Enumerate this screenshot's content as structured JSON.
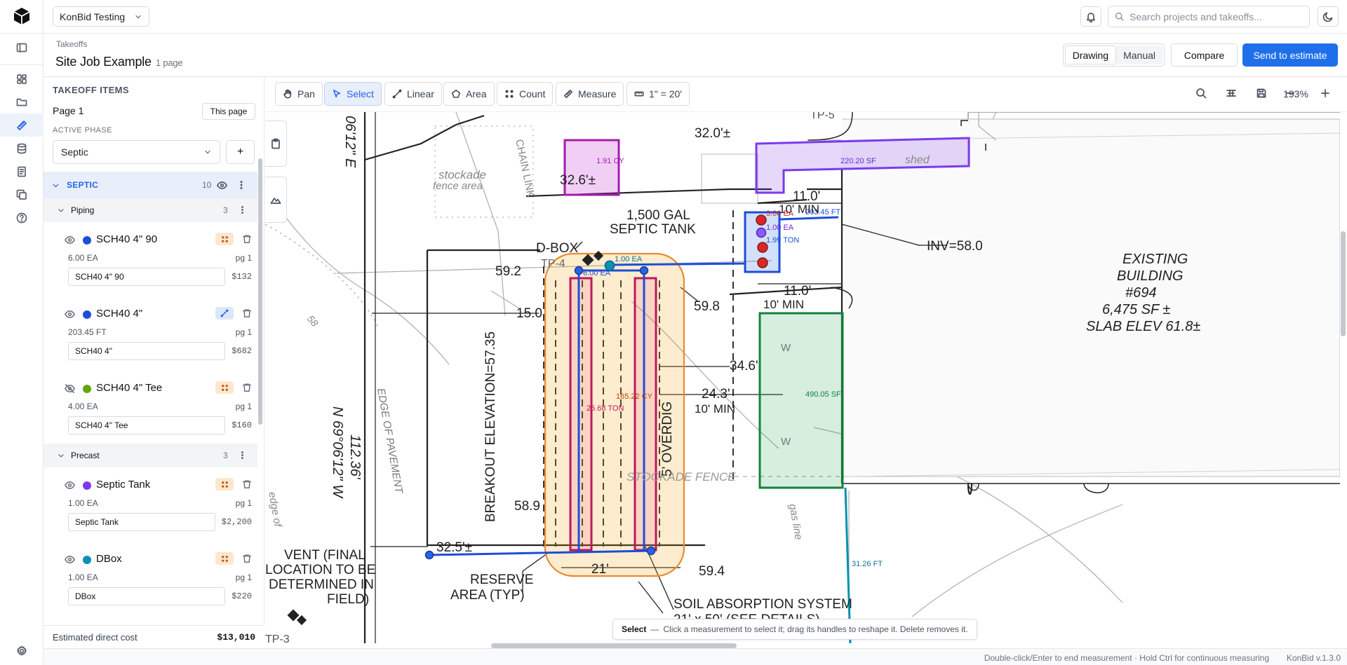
{
  "app": {
    "version": "KonBid v.1.3.0"
  },
  "project_selector": {
    "value": "KonBid Testing"
  },
  "search": {
    "placeholder": "Search projects and takeoffs..."
  },
  "header": {
    "breadcrumb": "Takeoffs",
    "title": "Site Job Example",
    "page_count": "1 page",
    "view_modes": [
      "Drawing",
      "Manual"
    ],
    "active_view": "Drawing",
    "compare_label": "Compare",
    "send_label": "Send to estimate"
  },
  "sidebar": {
    "title": "TAKEOFF ITEMS",
    "page_label": "Page 1",
    "this_page_label": "This page",
    "active_phase_label": "ACTIVE PHASE",
    "active_phase_value": "Septic",
    "add_label": "+",
    "phase": {
      "name": "SEPTIC",
      "count": "10"
    },
    "groups": [
      {
        "name": "Piping",
        "count": "3",
        "items": [
          {
            "name": "SCH40 4\" 90",
            "color": "#1d4ed8",
            "tool": "count",
            "qty": "6.00 EA",
            "page": "pg 1",
            "description": "SCH40 4\" 90",
            "price": "$132",
            "visible": true
          },
          {
            "name": "SCH40 4\"",
            "color": "#1d4ed8",
            "tool": "linear",
            "qty": "203.45 FT",
            "page": "pg 1",
            "description": "SCH40 4\"",
            "price": "$682",
            "visible": true
          },
          {
            "name": "SCH40 4\" Tee",
            "color": "#65a30d",
            "tool": "count",
            "qty": "4.00 EA",
            "page": "pg 1",
            "description": "SCH40 4\" Tee",
            "price": "$160",
            "visible": false
          }
        ]
      },
      {
        "name": "Precast",
        "count": "3",
        "items": [
          {
            "name": "Septic Tank",
            "color": "#7c3aed",
            "tool": "count",
            "qty": "1.00 EA",
            "page": "pg 1",
            "description": "Septic Tank",
            "price": "$2,200",
            "visible": true
          },
          {
            "name": "DBox",
            "color": "#0891b2",
            "tool": "count",
            "qty": "1.00 EA",
            "page": "pg 1",
            "description": "DBox",
            "price": "$220",
            "visible": true
          }
        ]
      }
    ],
    "footer": {
      "label": "Estimated direct cost",
      "value": "$13,010"
    }
  },
  "toolbar": {
    "tools": [
      "Pan",
      "Select",
      "Linear",
      "Area",
      "Count",
      "Measure",
      "1\" = 20'"
    ],
    "active_tool": "Select",
    "zoom": "193%"
  },
  "canvas": {
    "measurement_labels": {
      "cy_1": "1.91 CY",
      "sf_1": "220.20 SF",
      "ea_red": "3.00 EA",
      "ft_1": "203.45 FT",
      "ea_purple": "1.00 EA",
      "ton_1": "1.99 TON",
      "ea_dbox": "1.00 EA",
      "ea_tee": "6.00 EA",
      "cy_2": "165.22 CY",
      "ton_2": "25.68 TON",
      "sf_2": "490.05 SF",
      "ft_2": "31.26 FT"
    },
    "plan_text": {
      "tp5": "TP-5",
      "d320": "32.0'±",
      "d326": "32.6'±",
      "stockade": "stockade",
      "fence_area": "fence area",
      "chain_link": "CHAIN LINK",
      "shed": "shed",
      "d110a": "11.0'",
      "min10a": "10' MIN",
      "gal": "1,500 GAL",
      "septic_tank": "SEPTIC TANK",
      "inv": "INV=58.0",
      "dbox": "D-BOX",
      "tp4": "TP-4",
      "d592": "59.2",
      "d598": "59.8",
      "d110b": "11.0'",
      "min10b": "10' MIN",
      "existing": "EXISTING",
      "building": "BUILDING",
      "bldg_no": "#694",
      "bldg_sf": "6,475 SF ±",
      "slab": "SLAB ELEV 61.8±",
      "d150": "15.0",
      "d346": "34.6'",
      "d243": "24.3'",
      "min10c": "10' MIN",
      "overdig": "5' OVERDIG",
      "breakout": "BREAKOUT ELEVATION=57.35",
      "bearing_n": "N 69°06'12\" W",
      "dist_11236": "112.36'",
      "edge_pavement": "EDGE OF PAVEMENT",
      "stockade_fence": "STOCKADE FENCE",
      "d589": "58.9",
      "d325": "32.5'±",
      "d21": "21'",
      "d594": "59.4",
      "vent1": "VENT (FINAL",
      "vent2": "LOCATION TO BE",
      "vent3": "DETERMINED IN",
      "vent4": "FIELD)",
      "reserve1": "RESERVE",
      "reserve2": "AREA (TYP)",
      "soil": "SOIL ABSORPTION SYSTEM",
      "soil2": "21' x 50' (SEE DETAILS)",
      "tp3": "TP-3",
      "edge_of": "edge of",
      "gas_line": "gas line",
      "top_e": "06'12\" E",
      "contour58": "58",
      "w1": "W",
      "w2": "W"
    }
  },
  "hint": {
    "tool": "Select",
    "dash": "—",
    "text": "Click a measurement to select it; drag its handles to reshape it. Delete removes it."
  },
  "status": {
    "hint": "Double-click/Enter to end measurement · Hold Ctrl for continuous measuring"
  }
}
